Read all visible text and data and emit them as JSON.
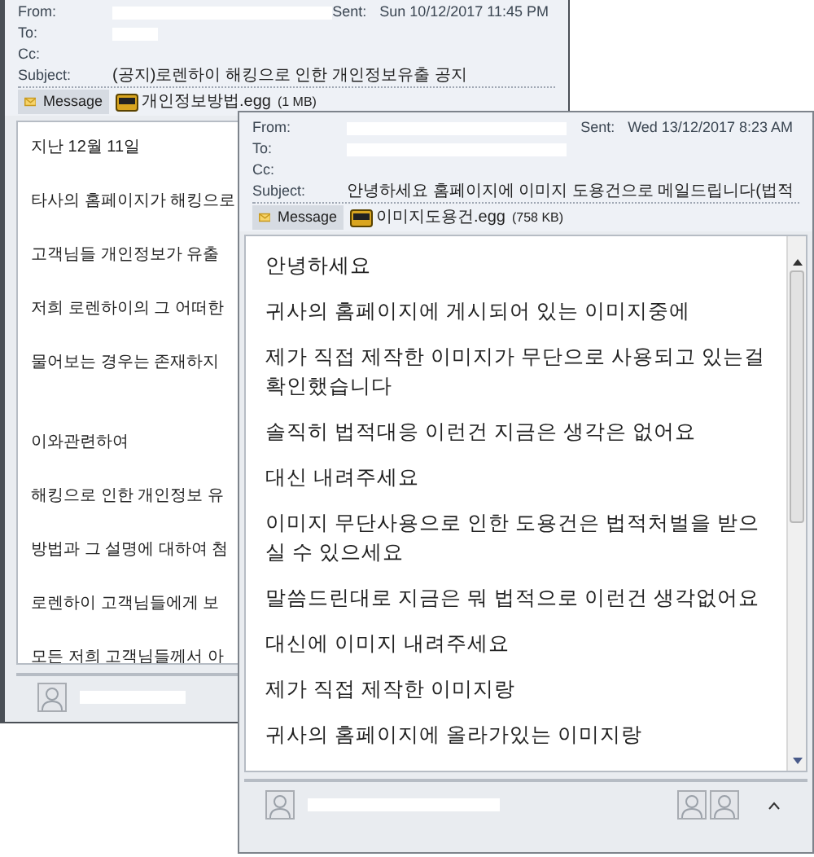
{
  "back_window": {
    "from_label": "From:",
    "sent_label": "Sent:",
    "sent": "Sun 10/12/2017 11:45 PM",
    "to_label": "To:",
    "cc_label": "Cc:",
    "subject_label": "Subject:",
    "subject": "(공지)로렌하이 해킹으로 인한 개인정보유출 공지",
    "message_tab": "Message",
    "attachment": {
      "name": "개인정보방법.egg",
      "size": "(1 MB)"
    },
    "body_paragraphs": [
      [
        "지난 12월 11일",
        "타사의 홈페이지가 해킹으로",
        "고객님들 개인정보가 유출",
        "저희 로렌하이의 그 어떠한",
        "물어보는 경우는 존재하지"
      ],
      [
        "이와관련하여",
        "해킹으로 인한 개인정보 유",
        "방법과 그 설명에 대하여 첨",
        "로렌하이 고객님들에게 보",
        "모든 저희 고객님들께서 아"
      ]
    ]
  },
  "front_window": {
    "from_label": "From:",
    "sent_label": "Sent:",
    "sent": "Wed 13/12/2017 8:23 AM",
    "to_label": "To:",
    "cc_label": "Cc:",
    "subject_label": "Subject:",
    "subject": "안녕하세요 홈페이지에 이미지 도용건으로 메일드립니다(법적",
    "message_tab": "Message",
    "attachment": {
      "name": "이미지도용건.egg",
      "size": "(758 KB)"
    },
    "body": [
      "안녕하세요",
      "귀사의 홈페이지에 게시되어 있는 이미지중에",
      "제가 직접 제작한 이미지가 무단으로 사용되고 있는걸 확인했습니다",
      "솔직히 법적대응 이런건 지금은 생각은 없어요",
      "대신 내려주세요",
      "이미지 무단사용으로 인한 도용건은 법적처벌을 받으실 수 있으세요",
      "말씀드린대로 지금은 뭐 법적으로 이런건 생각없어요",
      "대신에 이미지 내려주세요",
      "제가 직접 제작한 이미지랑",
      "귀사의 홈페이지에 올라가있는 이미지랑"
    ]
  }
}
